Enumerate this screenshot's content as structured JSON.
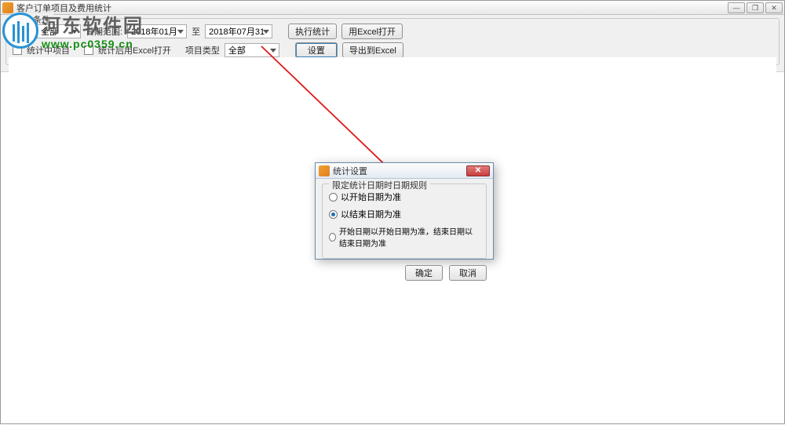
{
  "window": {
    "title": "客户订单项目及费用统计"
  },
  "watermark": {
    "cn": "河东软件园",
    "url": "www.pc0359.cn"
  },
  "toolbar": {
    "group_title": "统计条件",
    "customer_label": "客户:",
    "customer_value": "全部",
    "date_label": "日期范围:",
    "date_from": "2018年01月",
    "date_to_label": "至",
    "date_to": "2018年07月31",
    "include_subproject_label": "统计中项目",
    "open_after_export_label": "统计后用Excel打开",
    "project_type_label": "项目类型",
    "project_type_value": "全部",
    "btn_run": "执行统计",
    "btn_open_excel": "用Excel打开",
    "btn_settings": "设置",
    "btn_export_excel": "导出到Excel"
  },
  "dialog": {
    "title": "统计设置",
    "group_title": "限定统计日期时日期规则",
    "radio1": "以开始日期为准",
    "radio2": "以结束日期为准",
    "radio3": "开始日期以开始日期为准，结束日期以结束日期为准",
    "selected_index": 1,
    "btn_ok": "确定",
    "btn_cancel": "取消"
  }
}
